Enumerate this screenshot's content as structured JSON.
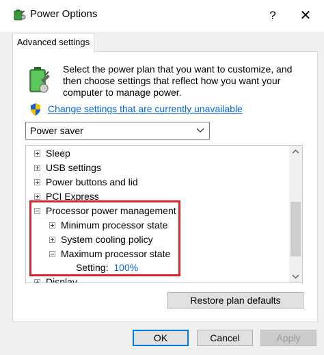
{
  "window": {
    "title": "Power Options",
    "help_label": "?",
    "close_label": "✕"
  },
  "tabs": [
    {
      "label": "Advanced settings"
    }
  ],
  "intro": {
    "text": "Select the power plan that you want to customize, and then choose settings that reflect how you want your computer to manage power."
  },
  "change_link": {
    "label": "Change settings that are currently unavailable"
  },
  "plan_select": {
    "value": "Power saver"
  },
  "tree": {
    "items": [
      {
        "label": "Sleep"
      },
      {
        "label": "USB settings"
      },
      {
        "label": "Power buttons and lid"
      },
      {
        "label": "PCI Express"
      },
      {
        "label": "Processor power management"
      },
      {
        "label": "Minimum processor state"
      },
      {
        "label": "System cooling policy"
      },
      {
        "label": "Maximum processor state"
      },
      {
        "label": "Setting:",
        "value": "100%"
      },
      {
        "label": "Display"
      }
    ]
  },
  "buttons": {
    "restore": "Restore plan defaults",
    "ok": "OK",
    "cancel": "Cancel",
    "apply": "Apply"
  },
  "colors": {
    "link": "#0a66d6",
    "highlight": "#e0202a",
    "setting_value": "#0a66d6",
    "ok_border": "#0078d7"
  },
  "icons": {
    "app": "power-plan-icon",
    "battery": "battery-plug-icon",
    "shield": "uac-shield-icon"
  }
}
